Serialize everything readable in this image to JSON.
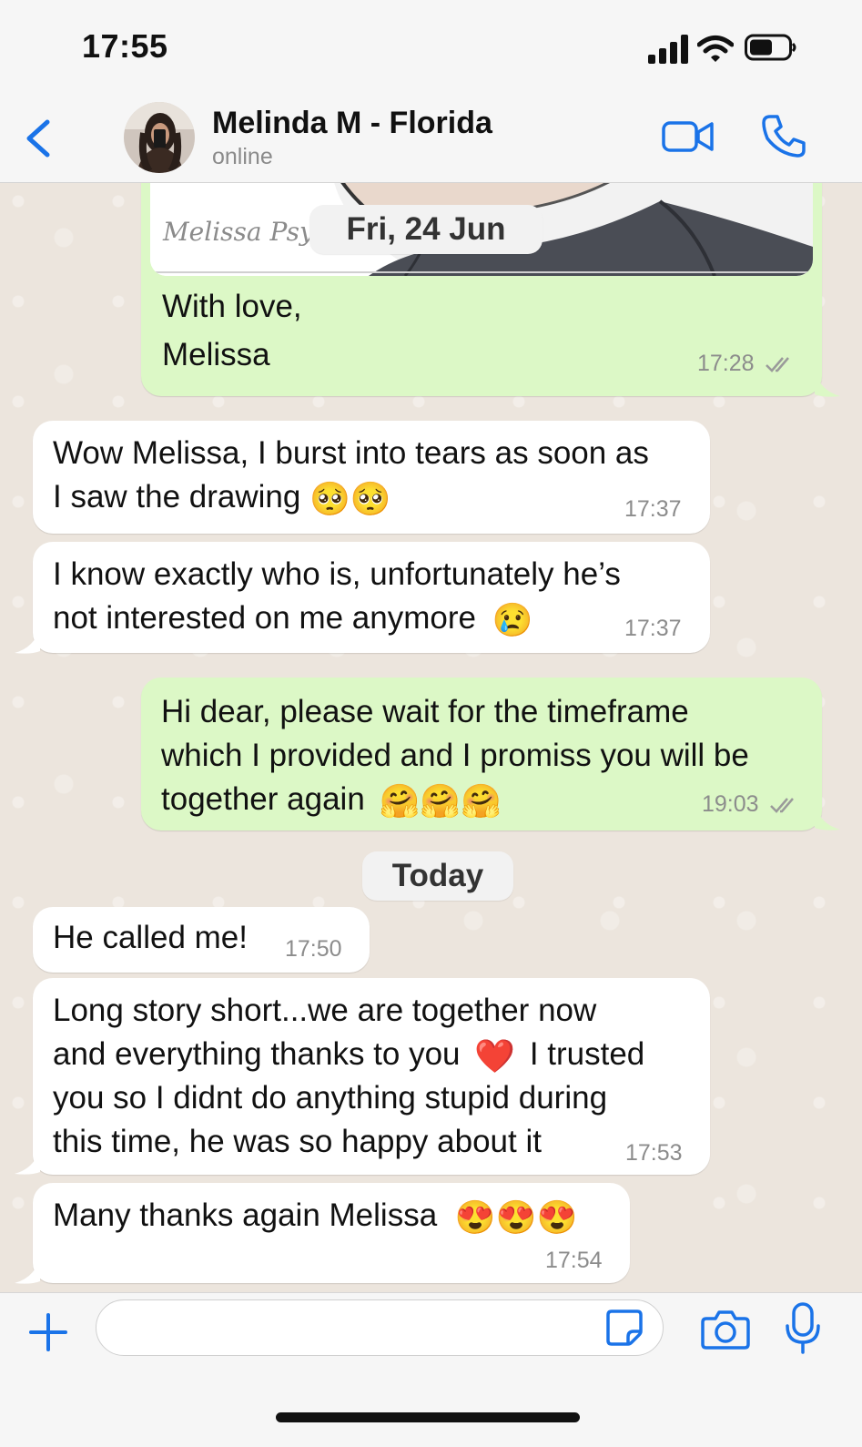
{
  "status_bar": {
    "time": "17:55",
    "icons": [
      "signal-icon",
      "wifi-icon",
      "battery-icon"
    ]
  },
  "header": {
    "back_icon": "chevron-left-icon",
    "contact_name": "Melinda M - Florida",
    "status": "online",
    "accent_color": "#1a73e8",
    "actions": [
      "video-call-icon",
      "voice-call-icon"
    ]
  },
  "chat": {
    "pinned_date": "Fri, 24 Jun",
    "today_label": "Today",
    "messages": [
      {
        "direction": "outgoing",
        "image_watermark": "Melissa Psy",
        "lines": [
          "With love,",
          "Melissa"
        ],
        "time": "17:28",
        "status": "read"
      },
      {
        "direction": "incoming",
        "lines": [
          "Wow  Melissa, I burst into tears as soon as",
          "I saw the drawing"
        ],
        "emoji": "🥺🥺",
        "time": "17:37"
      },
      {
        "direction": "incoming",
        "lines": [
          "I know exactly who is, unfortunately he’s",
          "not interested on me anymore"
        ],
        "emoji": "😢",
        "time": "17:37"
      },
      {
        "direction": "outgoing",
        "lines": [
          "Hi dear, please wait for the timeframe",
          "which I provided and I promiss you will be",
          "together again"
        ],
        "emoji": "🤗🤗🤗",
        "time": "19:03",
        "status": "read"
      },
      {
        "direction": "incoming",
        "lines": [
          "He called me!"
        ],
        "time": "17:50"
      },
      {
        "direction": "incoming",
        "lines": [
          "Long story short...we are together now",
          "and everything thanks to you",
          "I trusted",
          "you so I didnt do anything stupid during",
          "this time, he was so happy about it"
        ],
        "emoji": "❤️",
        "time": "17:53"
      },
      {
        "direction": "incoming",
        "lines": [
          "Many thanks again Melissa"
        ],
        "emoji": "😍😍😍",
        "time": "17:54"
      }
    ]
  },
  "input_bar": {
    "placeholder": "",
    "icons": [
      "plus-icon",
      "sticker-icon",
      "camera-icon",
      "microphone-icon"
    ]
  },
  "colors": {
    "outgoing_bubble": "#dcf8c6",
    "incoming_bubble": "#ffffff",
    "chat_background": "#ece5dd",
    "ios_blue": "#1a73e8"
  }
}
